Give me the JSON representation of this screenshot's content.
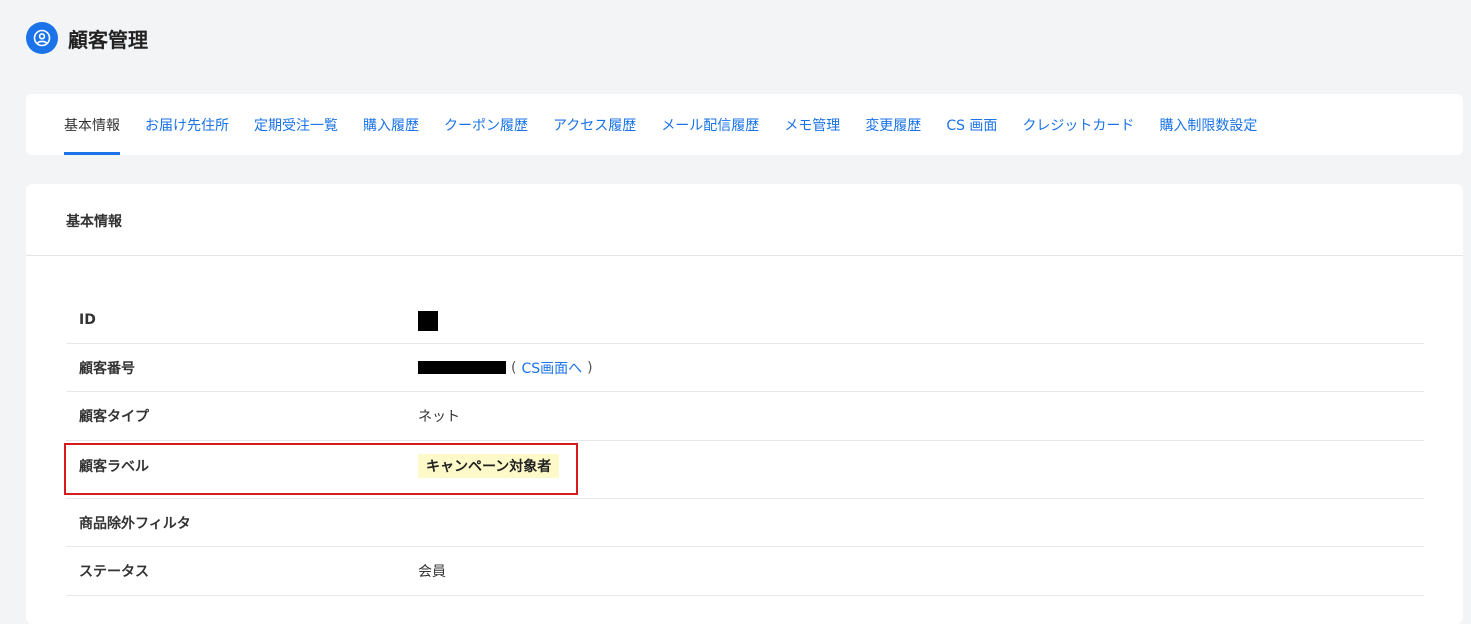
{
  "header": {
    "title": "顧客管理",
    "icon": "user-circle-icon"
  },
  "tabs": [
    {
      "label": "基本情報",
      "active": true
    },
    {
      "label": "お届け先住所"
    },
    {
      "label": "定期受注一覧"
    },
    {
      "label": "購入履歴"
    },
    {
      "label": "クーポン履歴"
    },
    {
      "label": "アクセス履歴"
    },
    {
      "label": "メール配信履歴"
    },
    {
      "label": "メモ管理"
    },
    {
      "label": "変更履歴"
    },
    {
      "label": "CS 画面"
    },
    {
      "label": "クレジットカード"
    },
    {
      "label": "購入制限数設定"
    }
  ],
  "section": {
    "title": "基本情報"
  },
  "rows": {
    "id": {
      "label": "ID"
    },
    "customer_number": {
      "label": "顧客番号",
      "paren_open": "(",
      "link": "CS画面へ",
      "paren_close": ")"
    },
    "customer_type": {
      "label": "顧客タイプ",
      "value": "ネット"
    },
    "customer_label": {
      "label": "顧客ラベル",
      "value": "キャンペーン対象者"
    },
    "product_filter": {
      "label": "商品除外フィルタ"
    },
    "status": {
      "label": "ステータス",
      "value": "会員"
    }
  },
  "colors": {
    "accent": "#1a73e8",
    "badge_bg": "#fdf9c8",
    "highlight": "#d81b1b"
  }
}
